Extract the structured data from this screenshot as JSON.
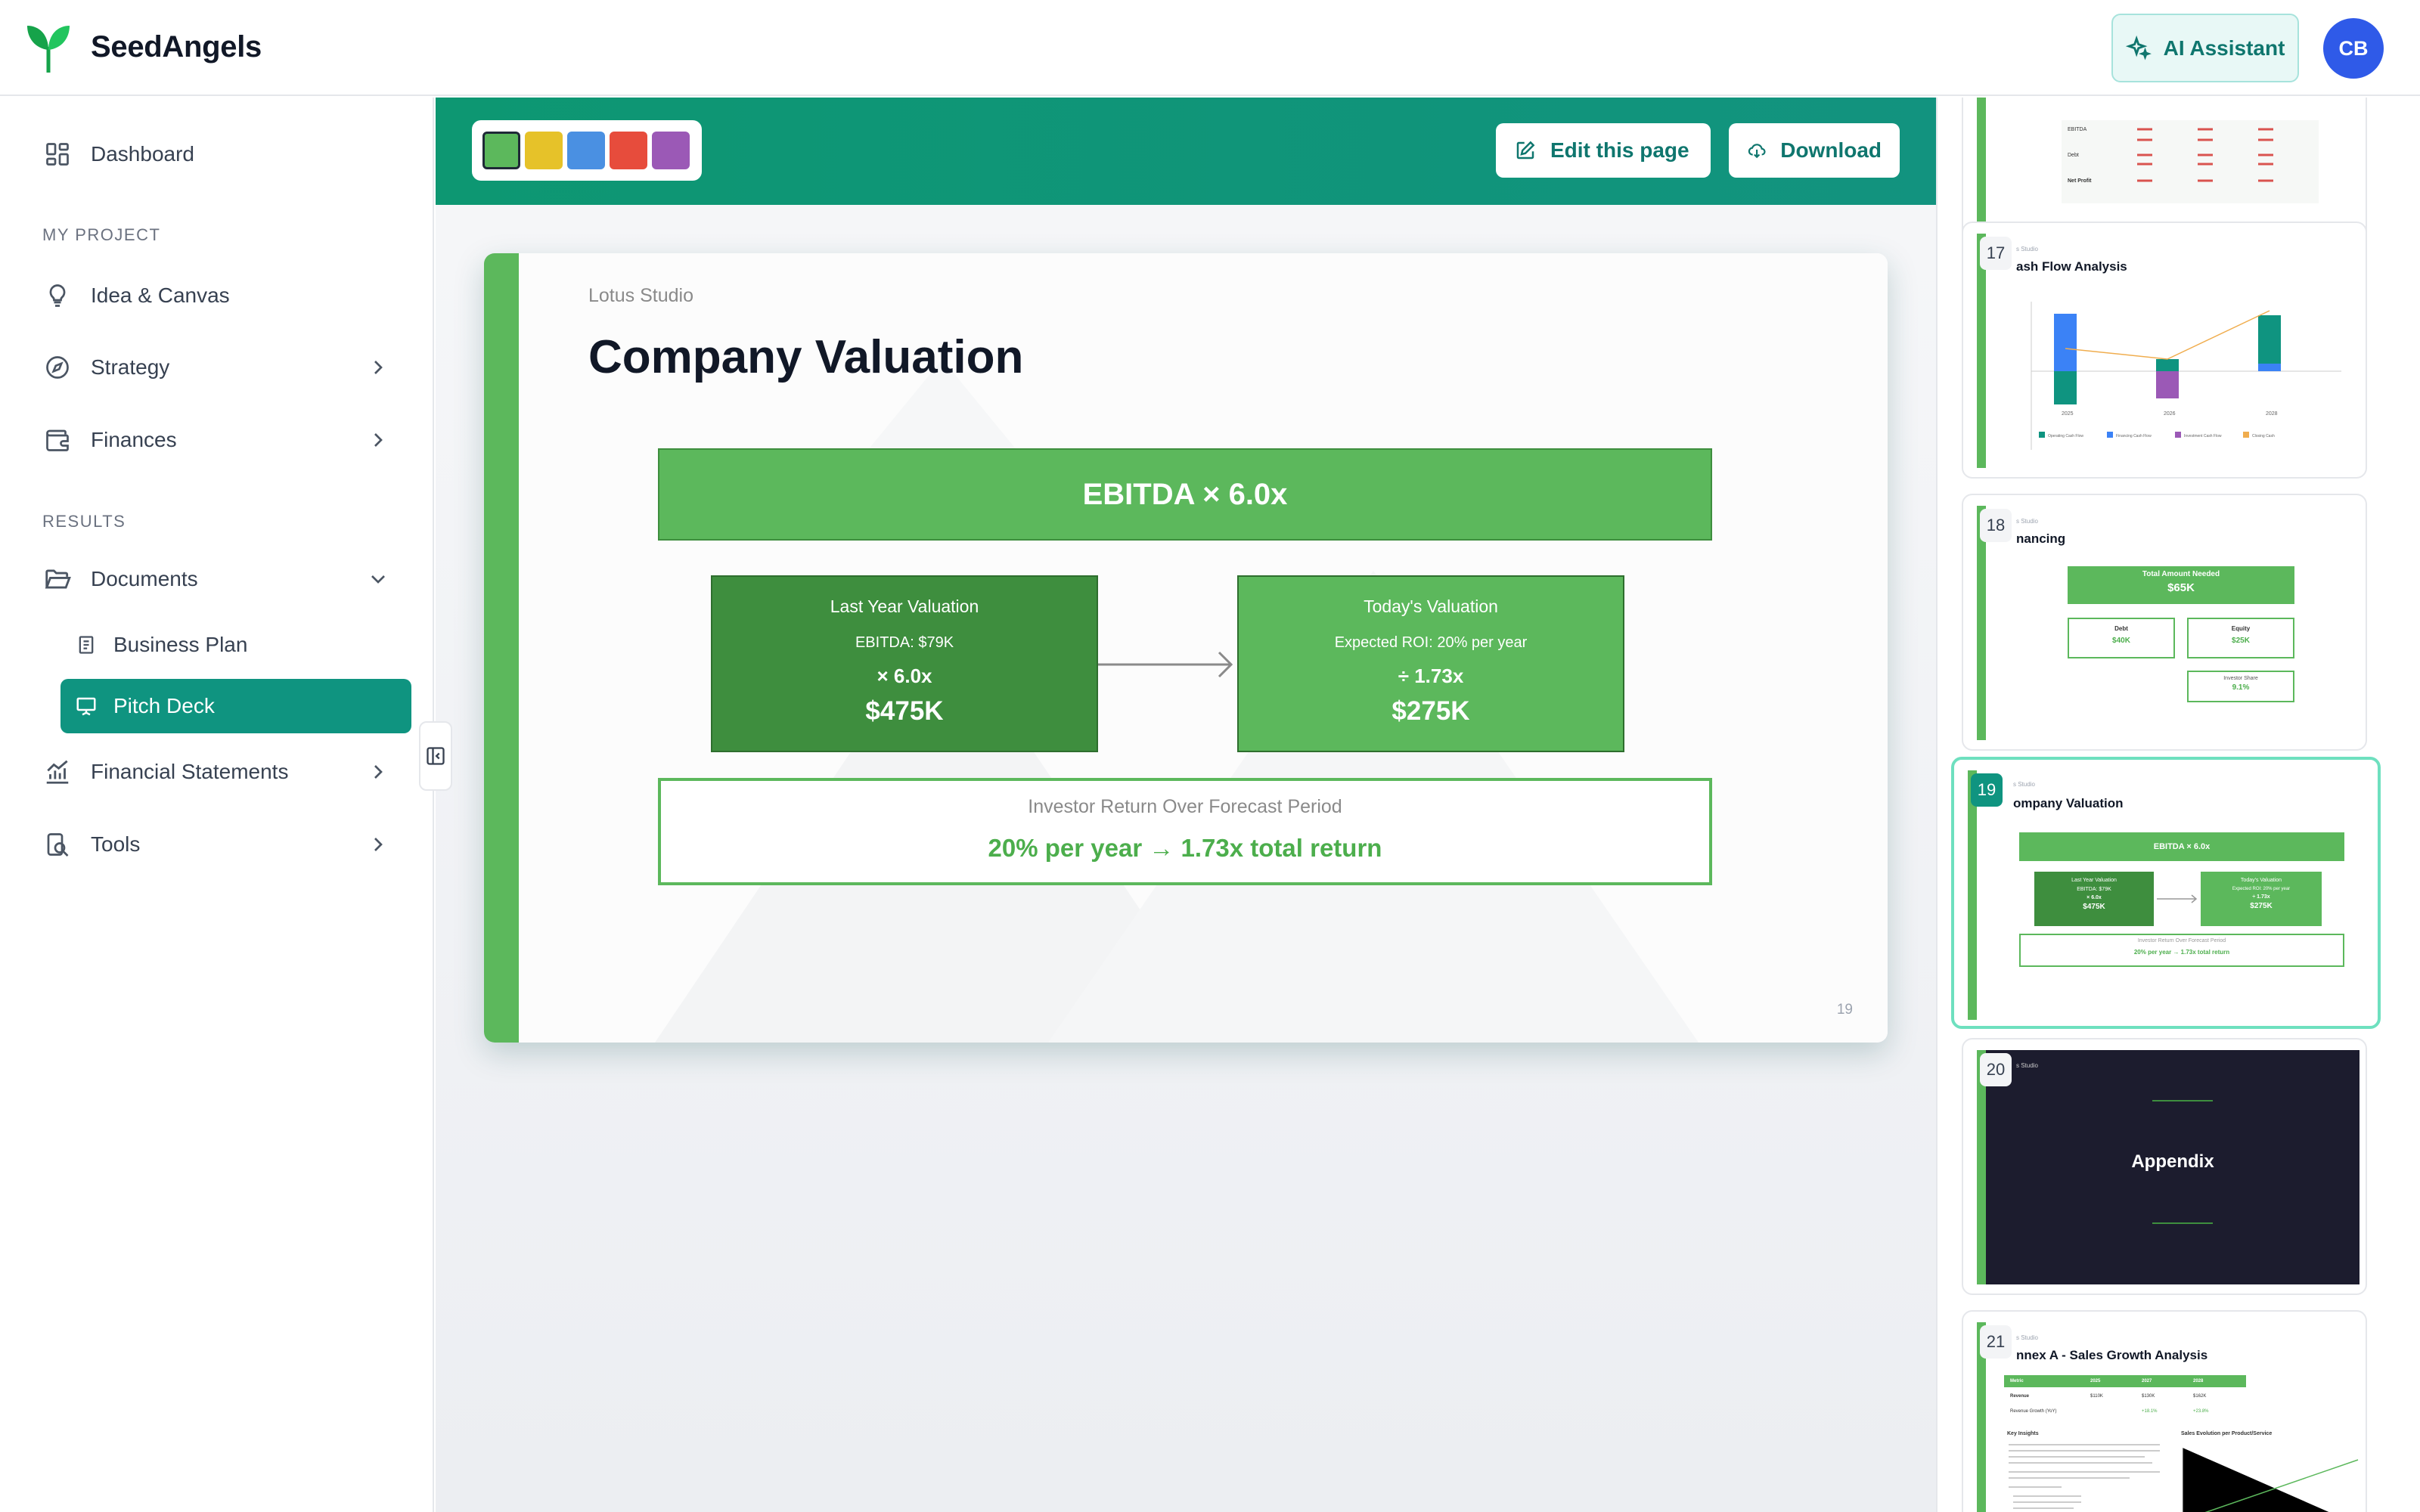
{
  "app": {
    "brand": "SeedAngels",
    "ai_assistant_label": "AI Assistant",
    "avatar_initials": "CB",
    "accent": "#0f9480"
  },
  "sidebar": {
    "dashboard": "Dashboard",
    "my_project_label": "MY PROJECT",
    "idea_canvas": "Idea & Canvas",
    "strategy": "Strategy",
    "finances": "Finances",
    "results_label": "RESULTS",
    "documents": "Documents",
    "business_plan": "Business Plan",
    "pitch_deck": "Pitch Deck",
    "financial_statements": "Financial Statements",
    "tools": "Tools"
  },
  "toolbar": {
    "colors": [
      "#5cb85c",
      "#e6c229",
      "#4a90e2",
      "#e74c3c",
      "#9b59b6"
    ],
    "selected_color": "#5cb85c",
    "edit_label": "Edit this page",
    "download_label": "Download"
  },
  "slide": {
    "company": "Lotus Studio",
    "title": "Company Valuation",
    "formula": "EBITDA × 6.0x",
    "last_year": {
      "title": "Last Year Valuation",
      "sub": "EBITDA: $79K",
      "mult": "× 6.0x",
      "value": "$475K"
    },
    "today": {
      "title": "Today's Valuation",
      "sub": "Expected ROI: 20% per year",
      "mult": "÷ 1.73x",
      "value": "$275K"
    },
    "return_label": "Investor Return Over Forecast Period",
    "return_value": "20% per year → 1.73x total return",
    "page_number": "19"
  },
  "thumbnails": {
    "t16": {
      "rows": [
        "EBITDA",
        "Debt",
        "Net Profit"
      ]
    },
    "t17": {
      "num": "17",
      "company": "s Studio",
      "title": "ash Flow Analysis",
      "years": [
        "2025",
        "2026",
        "2028"
      ],
      "legend": [
        "Operating Cash Flow",
        "Financing Cash Flow",
        "Investment Cash Flow",
        "Closing Cash"
      ]
    },
    "t18": {
      "num": "18",
      "company": "s Studio",
      "title": "nancing",
      "total_label": "Total Amount Needed",
      "total_value": "$65K",
      "debt_label": "Debt",
      "debt_value": "$40K",
      "equity_label": "Equity",
      "equity_value": "$25K",
      "share_label": "Investor Share",
      "share_value": "9.1%"
    },
    "t19": {
      "num": "19",
      "company": "s Studio",
      "title": "ompany Valuation",
      "formula": "EBITDA × 6.0x",
      "left_title": "Last Year Valuation",
      "left_sub": "EBITDA: $79K",
      "left_mult": "× 6.0x",
      "left_value": "$475K",
      "right_title": "Today's Valuation",
      "right_sub": "Expected ROI: 20% per year",
      "right_mult": "÷ 1.73x",
      "right_value": "$275K",
      "return_label": "Investor Return Over Forecast Period",
      "return_value": "20% per year → 1.73x total return"
    },
    "t20": {
      "num": "20",
      "company": "s Studio",
      "title": "Appendix"
    },
    "t21": {
      "num": "21",
      "company": "s Studio",
      "title": "nnex A - Sales Growth Analysis",
      "header": [
        "Metric",
        "2025",
        "2027",
        "2028"
      ],
      "row1": [
        "Revenue",
        "$110K",
        "$130K",
        "$162K"
      ],
      "row2": [
        "Revenue Growth (YoY)",
        "",
        "+18.1%",
        "+23.8%"
      ],
      "key_insights": "Key Insights",
      "sales_evolution": "Sales Evolution per Product/Service"
    }
  }
}
